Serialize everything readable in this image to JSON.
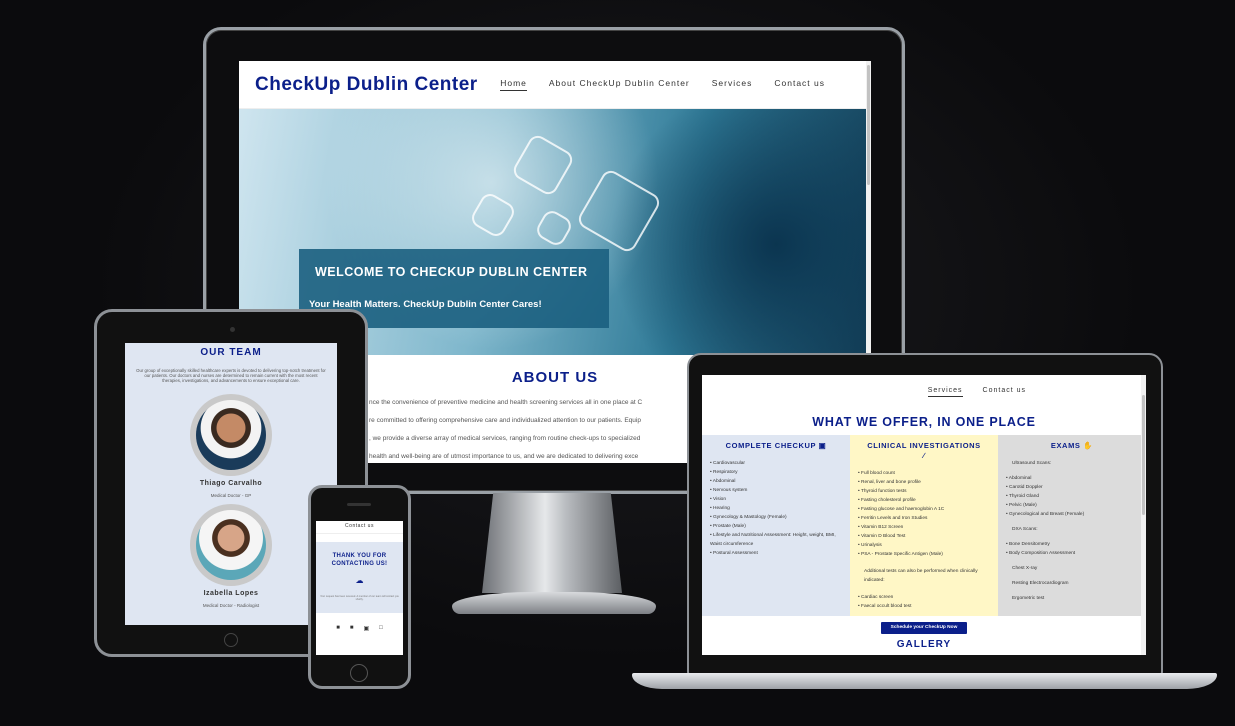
{
  "desktop": {
    "brand": "CheckUp Dublin Center",
    "nav": [
      "Home",
      "About CheckUp Dublin Center",
      "Services",
      "Contact us"
    ],
    "hero_title": "WELCOME TO CHECKUP DUBLIN CENTER",
    "hero_subtitle": "Your Health Matters. CheckUp Dublin Center Cares!",
    "about_title": "ABOUT US",
    "about_lines": [
      "nce the convenience of preventive medicine and health screening services all in one place at C",
      "re committed to offering comprehensive care and individualized attention to our patients. Equip",
      ", we provide a diverse array of medical services, ranging from routine check-ups to specialized",
      "health and well-being are of utmost importance to us, and we are dedicated to delivering exce"
    ]
  },
  "tablet": {
    "team_title": "OUR TEAM",
    "team_text": "Our group of exceptionally skilled healthcare experts is devoted to delivering top-notch treatment for our patients. Our doctors and nurses are determined to remain current with the most recent therapies, investigations, and advancements to ensure exceptional care.",
    "members": [
      {
        "name": "Thiago Carvalho",
        "role": "Medical Doctor - GP"
      },
      {
        "name": "Izabella Lopes",
        "role": "Medical Doctor - Radiologist"
      }
    ]
  },
  "phone": {
    "nav_item": "Contact us",
    "thanks": "THANK YOU FOR CONTACTING US!",
    "message": "Your request has been received. A member of our team will contact you shortly."
  },
  "laptop": {
    "nav": [
      "Services",
      "Contact us"
    ],
    "offer_title": "WHAT WE OFFER, IN ONE PLACE",
    "checkup": {
      "title": "COMPLETE CHECKUP",
      "items": [
        "Cardiovascular",
        "Respiratory",
        "Abdominal",
        "Nervous system",
        "Vision",
        "Hearing",
        "Gynecology & Mastology (Female)",
        "Prostate (Male)",
        "Lifestyle and Nutritional Assessment: Height, weight, BMI, Waist circumference",
        "Postural Assessment"
      ]
    },
    "clinical": {
      "title": "CLINICAL INVESTIGATIONS",
      "items": [
        "Full blood count",
        "Renal, liver and bone profile",
        "Thyroid function tests",
        "Fasting cholesterol profile",
        "Fasting glucose and haemoglobin A 1C",
        "Ferritin Levels and Iron Studies",
        "Vitamin B12 Screen",
        "Vitamin D Blood Test",
        "Urinalysis",
        "PSA - Prostate Specific Antigen (Male)"
      ],
      "note": "Additional tests can also be performed when clinically indicated:",
      "extra": [
        "Cardiac screen",
        "Faecal occult blood test"
      ]
    },
    "exams": {
      "title": "EXAMS",
      "ultrasound_label": "Ultrasound Scans:",
      "ultrasound": [
        "Abdominal",
        "Carotid Doppler",
        "Thyroid Gland",
        "Pelvic (Male)",
        "Gynecological and Breast (Female)"
      ],
      "dxa_label": "DXA Scans:",
      "dxa": [
        "Bone Densitometry",
        "Body Composition Assessment"
      ],
      "others": [
        "Chest X-ray",
        "Resting Electrocardiogram",
        "Ergometric test"
      ]
    },
    "schedule_button": "Schedule your CheckUp Now",
    "gallery_title": "GALLERY"
  }
}
